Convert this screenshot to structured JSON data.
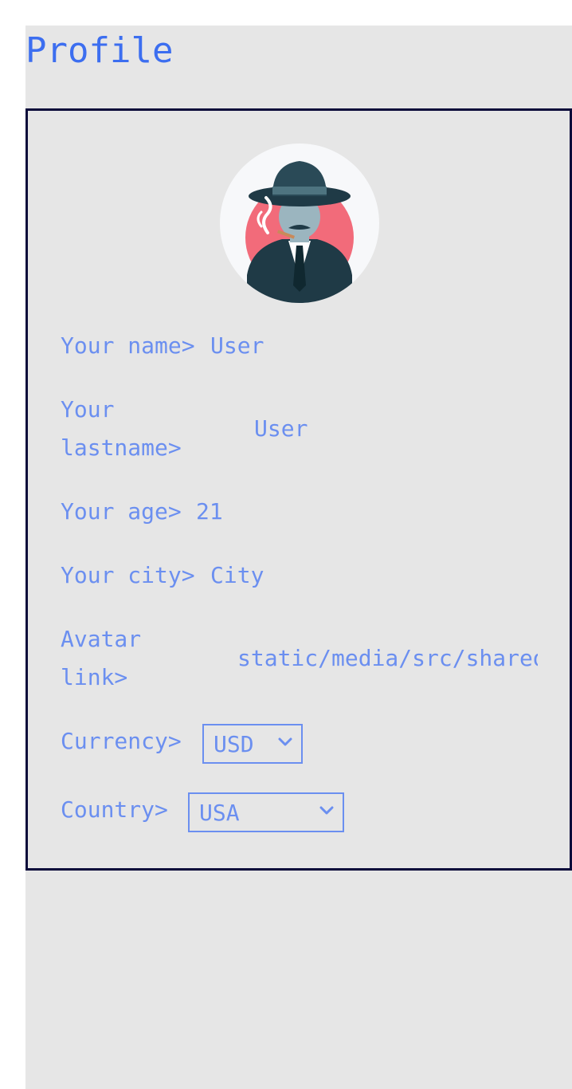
{
  "page": {
    "title": "Profile"
  },
  "profile": {
    "avatar_alt": "spy avatar",
    "fields": {
      "name": {
        "label": "Your name>",
        "value": "User"
      },
      "lastname": {
        "label_line1": "Your",
        "label_line2": "lastname>",
        "value": "User"
      },
      "age": {
        "label": "Your age>",
        "value": "21"
      },
      "city": {
        "label": "Your city>",
        "value": "City"
      },
      "avatar_link": {
        "label_line1": "Avatar",
        "label_line2": "link>",
        "value": "static/media/src/shared/images/avatar.png"
      },
      "currency": {
        "label": "Currency>",
        "selected": "USD"
      },
      "country": {
        "label": "Country>",
        "selected": "USA"
      }
    }
  },
  "colors": {
    "title": "#3c6ef0",
    "text": "#6b8ff0",
    "background": "#e6e6e6",
    "border": "#0a0a3a"
  }
}
